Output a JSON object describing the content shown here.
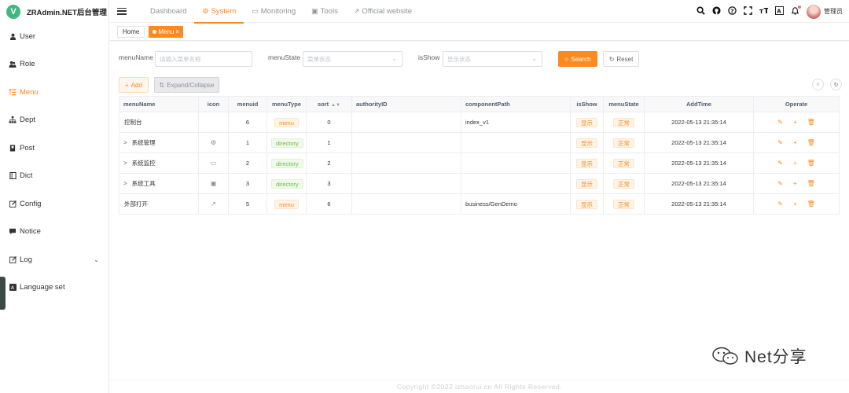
{
  "app": {
    "logo_letter": "V",
    "title": "ZRAdmin.NET后台管理"
  },
  "sidebar": {
    "items": [
      {
        "label": "User",
        "icon": "user-icon"
      },
      {
        "label": "Role",
        "icon": "role-icon"
      },
      {
        "label": "Menu",
        "icon": "menu-tree-icon",
        "active": true
      },
      {
        "label": "Dept",
        "icon": "dept-icon"
      },
      {
        "label": "Post",
        "icon": "post-icon"
      },
      {
        "label": "Dict",
        "icon": "dict-icon"
      },
      {
        "label": "Config",
        "icon": "config-icon"
      },
      {
        "label": "Notice",
        "icon": "notice-icon"
      },
      {
        "label": "Log",
        "icon": "log-icon",
        "expandable": true
      },
      {
        "label": "Language set",
        "icon": "language-icon"
      }
    ]
  },
  "topnav": {
    "items": [
      {
        "label": "Dashboard",
        "icon": ""
      },
      {
        "label": "System",
        "icon": "⚙",
        "active": true
      },
      {
        "label": "Monitoring",
        "icon": "▭"
      },
      {
        "label": "Tools",
        "icon": "▣"
      },
      {
        "label": "Official website",
        "icon": "↗"
      }
    ],
    "username": "管理员"
  },
  "tags": {
    "home": "Home",
    "active": "Menu",
    "close": "×"
  },
  "search": {
    "menuName_label": "menuName",
    "menuName_placeholder": "请输入菜单名称",
    "menuState_label": "menuState",
    "menuState_placeholder": "菜单状态",
    "isShow_label": "isShow",
    "isShow_placeholder": "显示状态",
    "search_button": "Search",
    "reset_button": "Reset"
  },
  "toolbar": {
    "add_button": "Add",
    "expand_button": "Expand/Collapse"
  },
  "table": {
    "headers": {
      "menuName": "menuName",
      "icon": "icon",
      "menuid": "menuid",
      "menuType": "menuType",
      "sort": "sort",
      "authorityID": "authorityID",
      "componentPath": "componentPath",
      "isShow": "isShow",
      "menuState": "menuState",
      "addTime": "AddTime",
      "operate": "Operate"
    },
    "rows": [
      {
        "name": "控制台",
        "icon": "",
        "id": "6",
        "type": "menu",
        "sort": "0",
        "auth": "",
        "path": "index_v1",
        "show": "显示",
        "state": "正常",
        "time": "2022-05-13 21:35:14"
      },
      {
        "name": "系统管理",
        "icon": "⚙",
        "id": "1",
        "type": "directory",
        "sort": "1",
        "auth": "",
        "path": "",
        "show": "显示",
        "state": "正常",
        "time": "2022-05-13 21:35:14"
      },
      {
        "name": "系统监控",
        "icon": "▭",
        "id": "2",
        "type": "directory",
        "sort": "2",
        "auth": "",
        "path": "",
        "show": "显示",
        "state": "正常",
        "time": "2022-05-13 21:35:14"
      },
      {
        "name": "系统工具",
        "icon": "▣",
        "id": "3",
        "type": "directory",
        "sort": "3",
        "auth": "",
        "path": "",
        "show": "显示",
        "state": "正常",
        "time": "2022-05-13 21:35:14"
      },
      {
        "name": "外部打开",
        "icon": "↗",
        "id": "5",
        "type": "menu",
        "sort": "6",
        "auth": "",
        "path": "business/GenDemo",
        "show": "显示",
        "state": "正常",
        "time": "2022-05-13 21:35:14"
      }
    ]
  },
  "footer": {
    "copyright": "Copyright ©2022 izhaorui.cn All Rights Reserved."
  },
  "watermark": {
    "text": "Net分享"
  },
  "colors": {
    "accent": "#fb8a1f",
    "success": "#67c23a"
  }
}
